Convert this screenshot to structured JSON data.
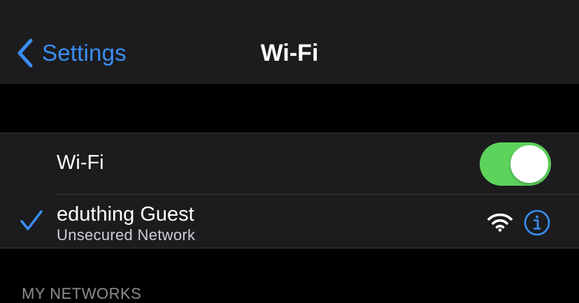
{
  "navbar": {
    "back_label": "Settings",
    "title": "Wi-Fi"
  },
  "wifi_row": {
    "label": "Wi-Fi",
    "toggle_on": true
  },
  "connected_network": {
    "name": "eduthing Guest",
    "subtitle": "Unsecured Network",
    "selected": true,
    "icons": [
      "checkmark-icon",
      "wifi-signal-icon",
      "info-icon"
    ]
  },
  "section_header": "MY NETWORKS",
  "colors": {
    "accent": "#3a8ef6",
    "toggle_on": "#5ed35c",
    "background": "#000000",
    "cell_background": "#1c1c1e"
  }
}
